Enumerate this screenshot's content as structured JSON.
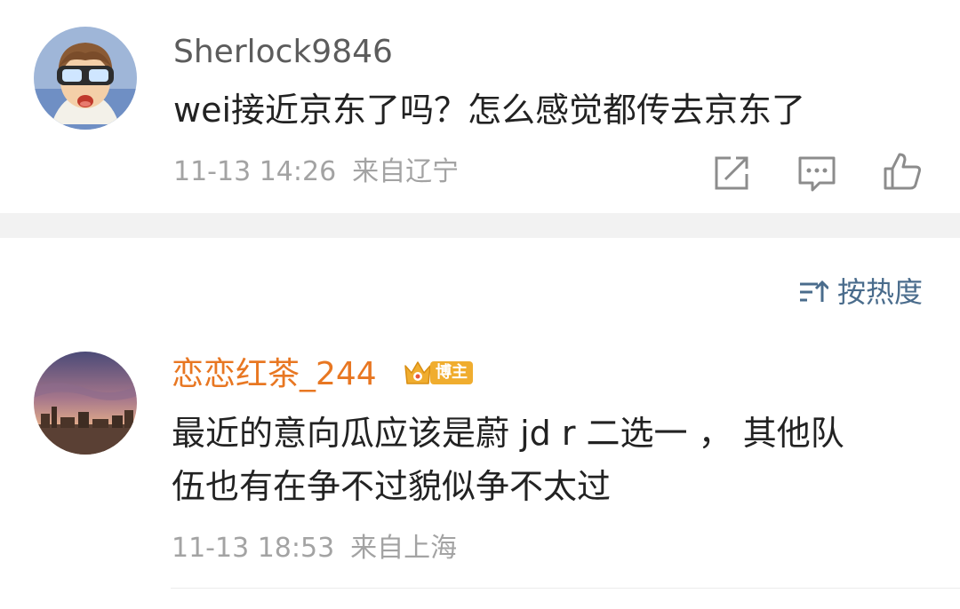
{
  "comment1": {
    "username": "Sherlock9846",
    "text": "wei接近京东了吗？怎么感觉都传去京东了",
    "date": "11-13 14:26",
    "location": "来自辽宁"
  },
  "sort": {
    "label": "按热度"
  },
  "comment2": {
    "username": "恋恋红茶_244",
    "badge": "博主",
    "text_line1": "最近的意向瓜应该是蔚 jd r 二选一 ， 其他队",
    "text_line2": "伍也有在争不过貌似争不太过",
    "date": "11-13 18:53",
    "location": "来自上海"
  },
  "colors": {
    "username_gray": "#5c5c5c",
    "username_orange": "#e87722",
    "meta_gray": "#a3a3a3",
    "sort_blue": "#4a6c8c",
    "badge_gold": "#f0ad2f"
  },
  "icons": [
    "share-icon",
    "comment-icon",
    "like-icon",
    "sort-icon",
    "crown-icon"
  ]
}
